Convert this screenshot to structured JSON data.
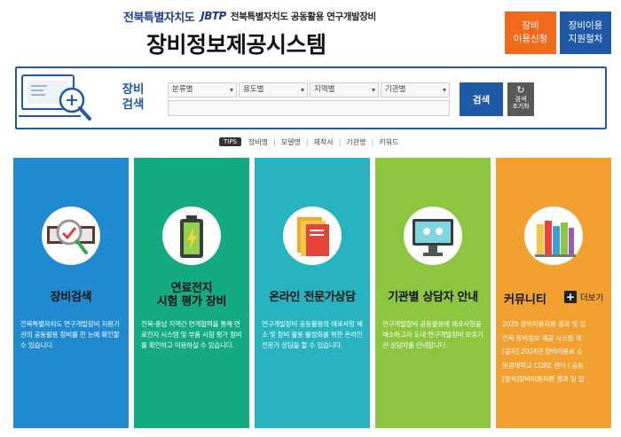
{
  "header": {
    "logo_jb": "전북특별자치도",
    "logo_jbtp": "JBTP",
    "logo_sub": "전북특별자치도 공동활용 연구개발장비",
    "title": "장비정보제공시스템",
    "btn_apply": "장비\n이용신청",
    "btn_proc": "장비이용\n지원절차"
  },
  "search": {
    "label": "장비\n검색",
    "selects": [
      "분류별",
      "용도별",
      "지역별",
      "기관별"
    ],
    "keyword_value": "",
    "search_label": "검색",
    "reset_label": "검색\n초기화"
  },
  "tips": {
    "badge": "TIPS",
    "items": [
      "장비명",
      "모델명",
      "제작사",
      "기관명",
      "키워드"
    ]
  },
  "cards": [
    {
      "title": "장비검색",
      "desc": "전북특별자치도 연구개발장비 지원기관의 공동활용 장비를 한 눈에 확인할 수 있습니다."
    },
    {
      "title": "연료전지\n시험 평가 장비",
      "desc": "전북-충남 지역간 연계협력을 통해 연료전지 시스템 및 부품 시험 평가 장비를 확인하고 이용하실 수 있습니다."
    },
    {
      "title": "온라인 전문가상담",
      "desc": "연구개발장비 공동활용의 애로사항 해소 및 장비 활용 활성화를 위한 온라인 전문가 상담을 할 수 있습니다."
    },
    {
      "title": "기관별 상담자 안내",
      "desc": "연구개발장비 공동활용에 애로사항을 해소하고자 도내 연구개발장비 보유기관 상담자를 안내합니다."
    }
  ],
  "community": {
    "title": "커뮤니티",
    "more": "더보기",
    "news": [
      "2025 장비이용지원 결과 및 입",
      "전북 장비정보 제공 시스템 개",
      "[공지] 2024년 장비이용료 소",
      "원광대학교 CORE 센터 / 공동",
      "[양식]장비이용지원 결과 및 입"
    ]
  },
  "colors": {
    "primary": "#1e5aa8",
    "orange": "#f26a1b",
    "card_blue": "#1f8ad0",
    "card_teal": "#15ab82",
    "card_cyan": "#27b3c0",
    "card_green": "#8cc63f",
    "card_orange": "#f2a030"
  }
}
